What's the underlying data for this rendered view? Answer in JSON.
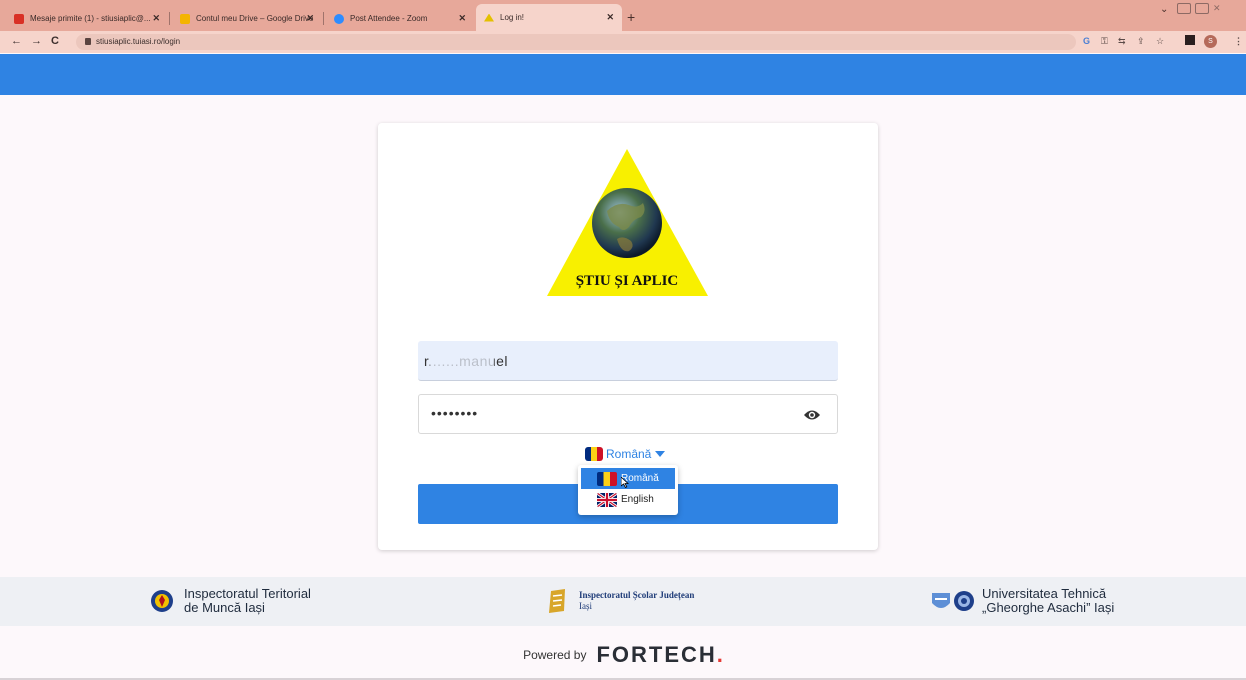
{
  "browser": {
    "tabs": [
      {
        "title": "Mesaje primite (1) - stiusiaplic@...",
        "close": "✕",
        "color": "#d93025"
      },
      {
        "title": "Contul meu Drive – Google Drive",
        "close": "✕",
        "color": "#f4b400"
      },
      {
        "title": "Post Attendee - Zoom",
        "close": "✕",
        "color": "#2d8cff"
      },
      {
        "title": "Log in!",
        "close": "✕",
        "color": "#e4c000"
      }
    ],
    "new_tab": "+",
    "url": "stiusiaplic.tuiasi.ro/login",
    "nav": {
      "back": "←",
      "forward": "→",
      "reload": "C"
    },
    "profile_initial": "S",
    "toolbar_icons": [
      "google-lens-icon",
      "key-icon",
      "translate-icon",
      "share-icon",
      "star-icon",
      "sidepanel-icon",
      "profile-icon",
      "menu-icon"
    ]
  },
  "login": {
    "logo_text": "ȘTIU ȘI APLIC",
    "username_value": "r.......manuel",
    "password_value": "••••••••",
    "language": {
      "selected": "Română",
      "options": [
        "Română",
        "English"
      ]
    }
  },
  "partners": [
    {
      "line1": "Inspectoratul Teritorial",
      "line2": "de Muncă Iași"
    },
    {
      "line1": "Inspectoratul Școlar Județean",
      "line2": "Iași"
    },
    {
      "line1": "Universitatea Tehnică",
      "line2": "„Gheorghe Asachi” Iași"
    }
  ],
  "footer": {
    "powered_by": "Powered by",
    "brand": "FORTECH",
    "brand_dot": "."
  },
  "colors": {
    "primary": "#2f83e3",
    "tabbar": "#e7a89a",
    "addrbar": "#f6d4cb"
  }
}
